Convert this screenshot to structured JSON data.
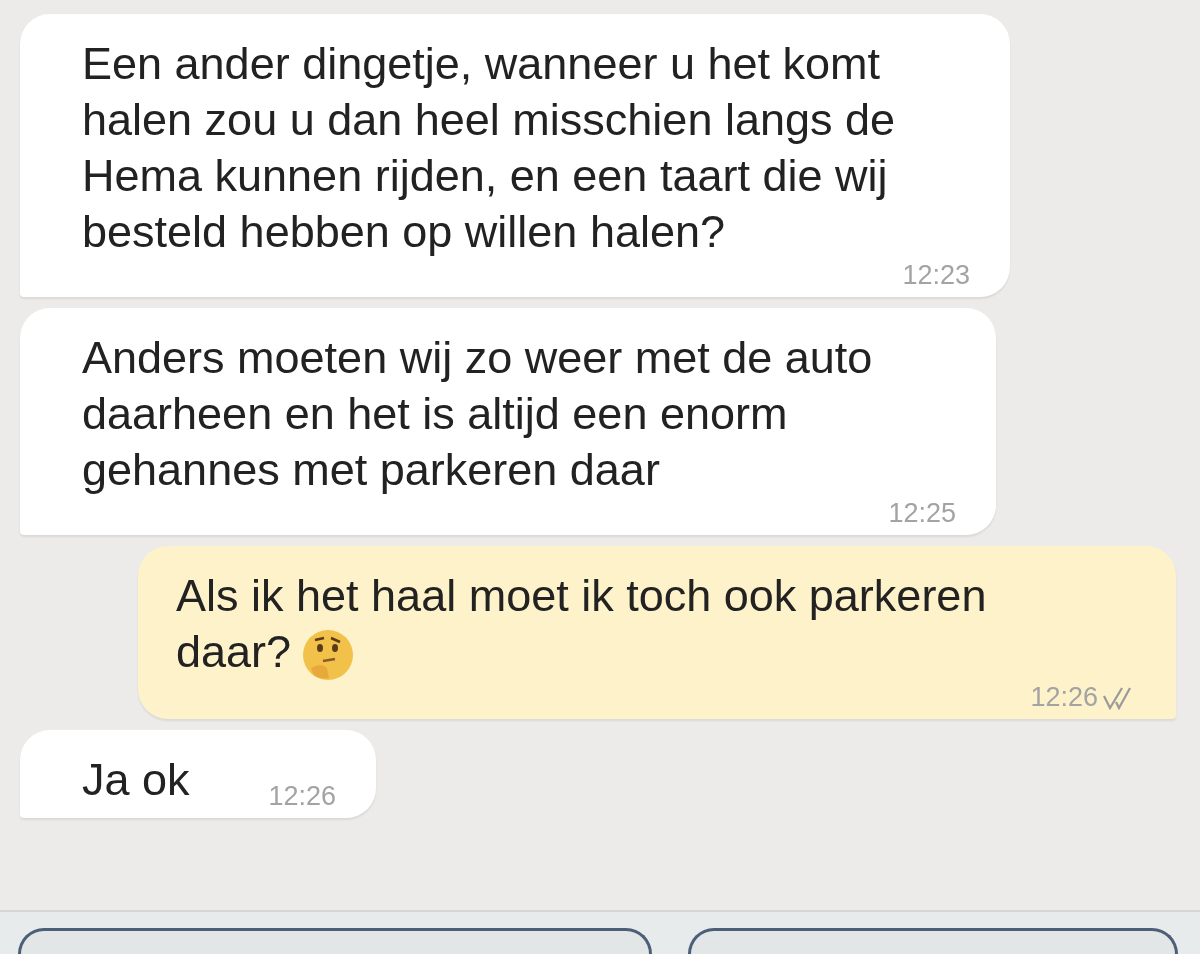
{
  "messages": [
    {
      "kind": "incoming",
      "text": "Een ander dingetje, wanneer u het komt halen zou u dan heel misschien langs de Hema kunnen rijden, en een taart die wij besteld hebben op willen halen?",
      "time": "12:23"
    },
    {
      "kind": "incoming",
      "text": "Anders moeten wij zo weer met de auto daarheen en het is altijd een enorm gehannes met parkeren daar",
      "time": "12:25"
    },
    {
      "kind": "outgoing",
      "text": "Als ik het haal moet ik toch ook parkeren daar?",
      "emoji": true,
      "time": "12:26",
      "read": true
    },
    {
      "kind": "incoming",
      "text": "Ja ok",
      "time": "12:26"
    }
  ]
}
